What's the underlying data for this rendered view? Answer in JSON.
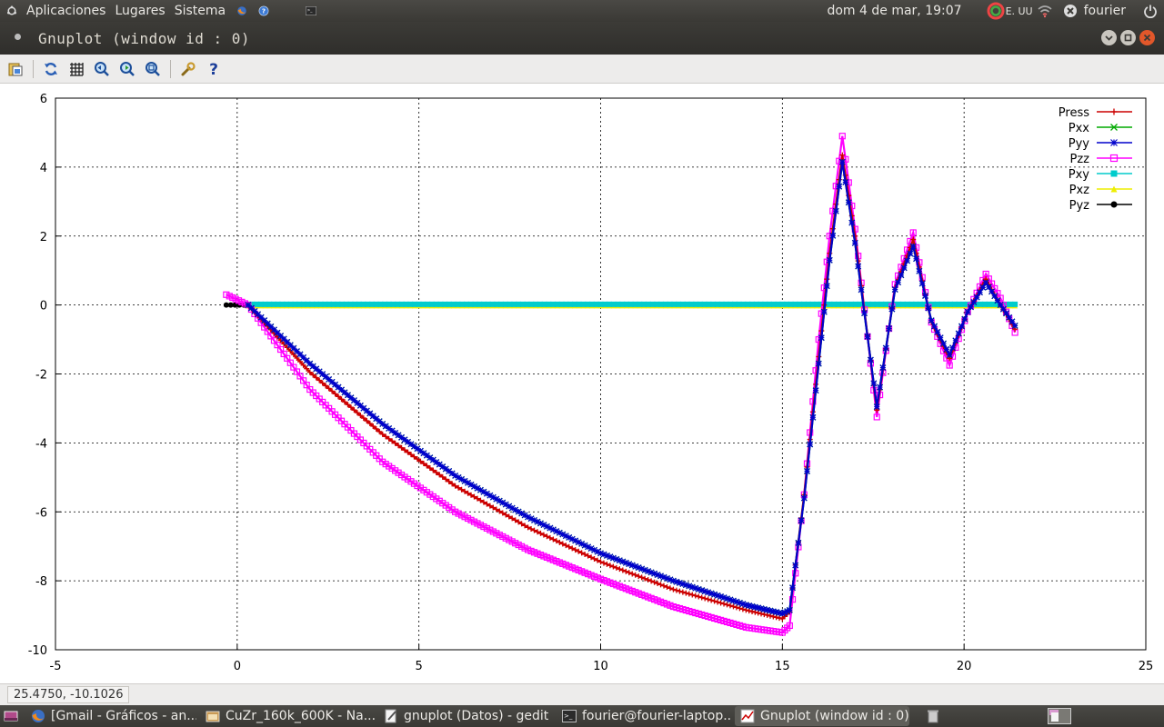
{
  "topbar": {
    "menus": [
      "Aplicaciones",
      "Lugares",
      "Sistema"
    ],
    "datetime": "dom  4 de mar, 19:07",
    "keyboard_layout": "E. UU",
    "user": "fourier"
  },
  "window": {
    "title": "Gnuplot (window id : 0)"
  },
  "toolbar": {
    "icons": [
      "copy-to-clipboard-icon",
      "replot-icon",
      "grid-icon",
      "zoom-previous-icon",
      "zoom-next-icon",
      "autoscale-icon",
      "settings-icon",
      "help-icon"
    ]
  },
  "status": {
    "coordinates": "25.4750, -10.1026"
  },
  "taskbar": {
    "items": [
      {
        "label": "[Gmail - Gráficos - an...",
        "icon": "firefox-icon"
      },
      {
        "label": "CuZr_160k_600K - Na...",
        "icon": "folder-icon"
      },
      {
        "label": "gnuplot (Datos) - gedit",
        "icon": "text-editor-icon"
      },
      {
        "label": "fourier@fourier-laptop...",
        "icon": "terminal-icon"
      },
      {
        "label": "Gnuplot (window id : 0)",
        "icon": "gnuplot-icon"
      }
    ]
  },
  "chart_data": {
    "type": "line",
    "title": "",
    "xlabel": "",
    "ylabel": "",
    "xlim": [
      -5,
      25
    ],
    "ylim": [
      -10,
      6
    ],
    "xticks": [
      -5,
      0,
      5,
      10,
      15,
      20,
      25
    ],
    "yticks": [
      -10,
      -8,
      -6,
      -4,
      -2,
      0,
      2,
      4,
      6
    ],
    "grid": true,
    "legend_position": "top-right",
    "series": [
      {
        "name": "Press",
        "color": "#cc0000",
        "marker": "plus",
        "x": [
          0.3,
          2,
          4,
          6,
          8,
          10,
          12,
          14,
          15,
          15.2,
          15.6,
          16.0,
          16.3,
          16.65,
          17.0,
          17.6,
          18.1,
          18.6,
          19.1,
          19.6,
          20.1,
          20.6,
          21.0,
          21.4
        ],
        "y": [
          0.0,
          -1.95,
          -3.75,
          -5.25,
          -6.45,
          -7.45,
          -8.25,
          -8.85,
          -9.1,
          -8.9,
          -5.5,
          -1.5,
          1.5,
          4.35,
          2.0,
          -3.05,
          0.5,
          1.9,
          -0.5,
          -1.55,
          -0.2,
          0.75,
          0.0,
          -0.7
        ]
      },
      {
        "name": "Pxx",
        "color": "#00aa00",
        "marker": "cross",
        "x": [
          0.3,
          2,
          4,
          6,
          8,
          10,
          12,
          14,
          15,
          15.2,
          15.6,
          16.0,
          16.3,
          16.65,
          17.0,
          17.6,
          18.1,
          18.6,
          19.1,
          19.6,
          20.1,
          20.6,
          21.0,
          21.4
        ],
        "y": [
          0.0,
          -1.7,
          -3.45,
          -4.95,
          -6.15,
          -7.2,
          -8.0,
          -8.7,
          -8.95,
          -8.85,
          -5.6,
          -1.7,
          1.3,
          4.15,
          1.8,
          -2.95,
          0.45,
          1.7,
          -0.45,
          -1.45,
          -0.2,
          0.65,
          0.0,
          -0.6
        ]
      },
      {
        "name": "Pyy",
        "color": "#0000cc",
        "marker": "star",
        "x": [
          0.3,
          2,
          4,
          6,
          8,
          10,
          12,
          14,
          15,
          15.2,
          15.6,
          16.0,
          16.3,
          16.65,
          17.0,
          17.6,
          18.1,
          18.6,
          19.1,
          19.6,
          20.1,
          20.6,
          21.0,
          21.4
        ],
        "y": [
          0.0,
          -1.7,
          -3.45,
          -4.95,
          -6.15,
          -7.2,
          -8.0,
          -8.7,
          -8.95,
          -8.85,
          -5.6,
          -1.7,
          1.3,
          4.15,
          1.8,
          -2.95,
          0.45,
          1.7,
          -0.45,
          -1.45,
          -0.2,
          0.65,
          0.0,
          -0.6
        ]
      },
      {
        "name": "Pzz",
        "color": "#ff00ff",
        "marker": "square",
        "x": [
          -0.3,
          0.3,
          2,
          4,
          6,
          8,
          10,
          12,
          14,
          15,
          15.2,
          15.6,
          16.0,
          16.3,
          16.65,
          17.0,
          17.6,
          18.1,
          18.6,
          19.1,
          19.6,
          20.1,
          20.6,
          21.0,
          21.4
        ],
        "y": [
          0.3,
          0.0,
          -2.45,
          -4.55,
          -6.0,
          -7.1,
          -7.95,
          -8.75,
          -9.35,
          -9.5,
          -9.3,
          -5.5,
          -1.0,
          2.0,
          4.9,
          2.2,
          -3.25,
          0.6,
          2.1,
          -0.5,
          -1.75,
          -0.2,
          0.9,
          0.2,
          -0.8
        ]
      },
      {
        "name": "Pxy",
        "color": "#00cccc",
        "marker": "filled-square",
        "x": [
          0.3,
          5,
          10,
          15,
          21.4
        ],
        "y": [
          0.02,
          0.02,
          0.02,
          0.02,
          0.02
        ]
      },
      {
        "name": "Pxz",
        "color": "#eeee00",
        "marker": "filled-triangle",
        "x": [
          0.3,
          5,
          10,
          15,
          21.4
        ],
        "y": [
          -0.02,
          -0.02,
          -0.02,
          -0.02,
          -0.02
        ]
      },
      {
        "name": "Pyz",
        "color": "#000000",
        "marker": "filled-circle",
        "x": [
          -0.3,
          0.3,
          5,
          10,
          15,
          21.4
        ],
        "y": [
          0.0,
          0.0,
          0.0,
          0.0,
          0.0,
          0.0
        ]
      }
    ]
  }
}
